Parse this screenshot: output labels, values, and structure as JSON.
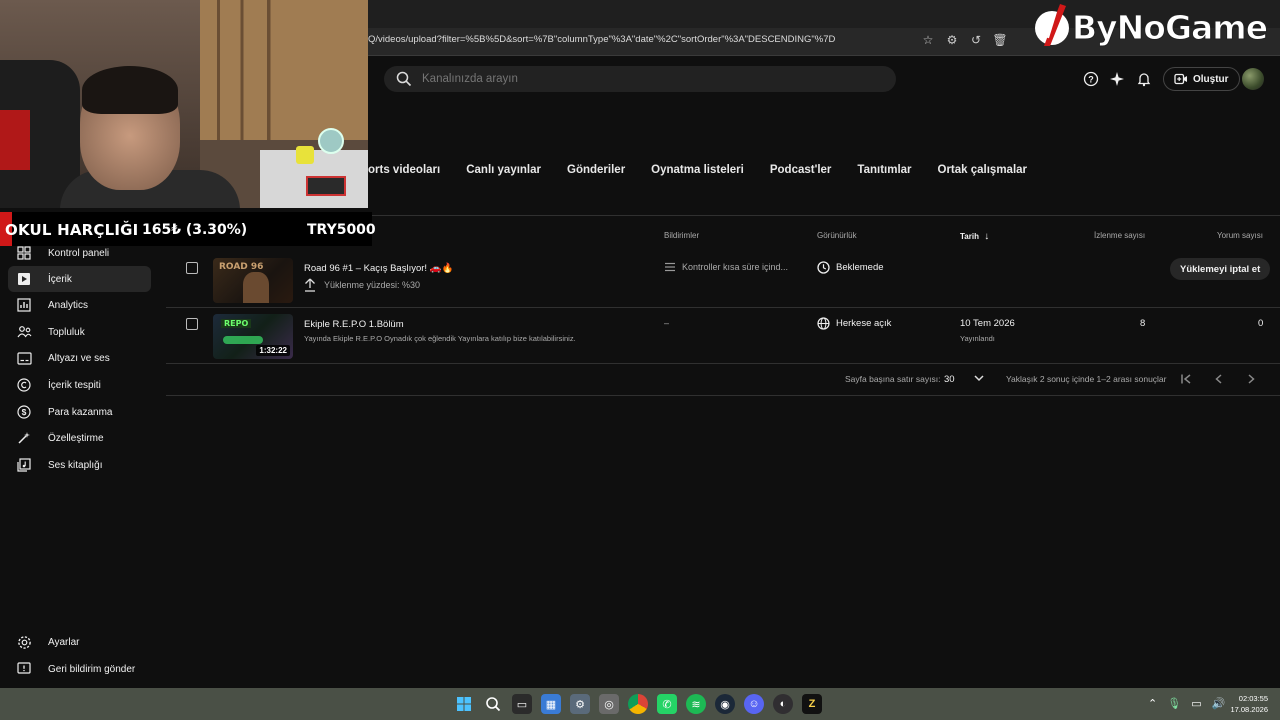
{
  "browser": {
    "url": "Q/videos/upload?filter=%5B%5D&sort=%7B\"columnType\"%3A\"date\"%2C\"sortOrder\"%3A\"DESCENDING\"%7D"
  },
  "header": {
    "search_placeholder": "Kanalınızda arayın",
    "create_label": "Oluştur"
  },
  "tabs": [
    "orts videoları",
    "Canlı yayınlar",
    "Gönderiler",
    "Oynatma listeleri",
    "Podcast'ler",
    "Tanıtımlar",
    "Ortak çalışmalar"
  ],
  "ticker": {
    "name": "OKUL HARÇLIĞI",
    "change": "165₺ (3.30%)",
    "price": "TRY5000"
  },
  "sidebar": {
    "items": [
      {
        "label": "Kontrol paneli",
        "icon": "dashboard-icon"
      },
      {
        "label": "İçerik",
        "icon": "content-icon",
        "active": true
      },
      {
        "label": "Analytics",
        "icon": "analytics-icon"
      },
      {
        "label": "Topluluk",
        "icon": "community-icon"
      },
      {
        "label": "Altyazı ve ses",
        "icon": "subtitles-icon"
      },
      {
        "label": "İçerik tespiti",
        "icon": "copyright-icon"
      },
      {
        "label": "Para kazanma",
        "icon": "dollar-icon"
      },
      {
        "label": "Özelleştirme",
        "icon": "magic-wand-icon"
      },
      {
        "label": "Ses kitaplığı",
        "icon": "audio-library-icon"
      }
    ],
    "bottom": [
      {
        "label": "Ayarlar",
        "icon": "settings-icon"
      },
      {
        "label": "Geri bildirim gönder",
        "icon": "feedback-icon"
      }
    ]
  },
  "table": {
    "headers": {
      "notifications": "Bildirimler",
      "visibility": "Görünürlük",
      "date": "Tarih",
      "views": "İzlenme sayısı",
      "comments": "Yorum sayısı"
    },
    "rows": [
      {
        "title": "Road 96 #1 – Kaçış Başlıyor! 🚗🔥",
        "upload_status": "Yüklenme yüzdesi: %30",
        "notification": "Kontroller kısa süre içind...",
        "visibility": "Beklemede",
        "action": "Yüklemeyi iptal et",
        "thumb_text": "ROAD 96"
      },
      {
        "title": "Ekiple R.E.P.O 1.Bölüm",
        "description": "Yayında Ekiple R.E.P.O Oynadık çok eğlendik Yayınlara katılıp bize katılabilirsiniz.",
        "duration": "1:32:22",
        "notification": "–",
        "visibility": "Herkese açık",
        "date": "10 Tem 2026",
        "date_status": "Yayınlandı",
        "views": "8",
        "comments": "0",
        "thumb_text": "REPO"
      }
    ]
  },
  "pagination": {
    "rows_per_page_label": "Sayfa başına satır sayısı:",
    "rows_per_page": "30",
    "range_text": "Yaklaşık 2 sonuç içinde 1–2 arası sonuçlar"
  },
  "logo": {
    "text": "ByNoGame"
  },
  "taskbar": {
    "time": "02:03:55",
    "date": "17.08.2026"
  }
}
